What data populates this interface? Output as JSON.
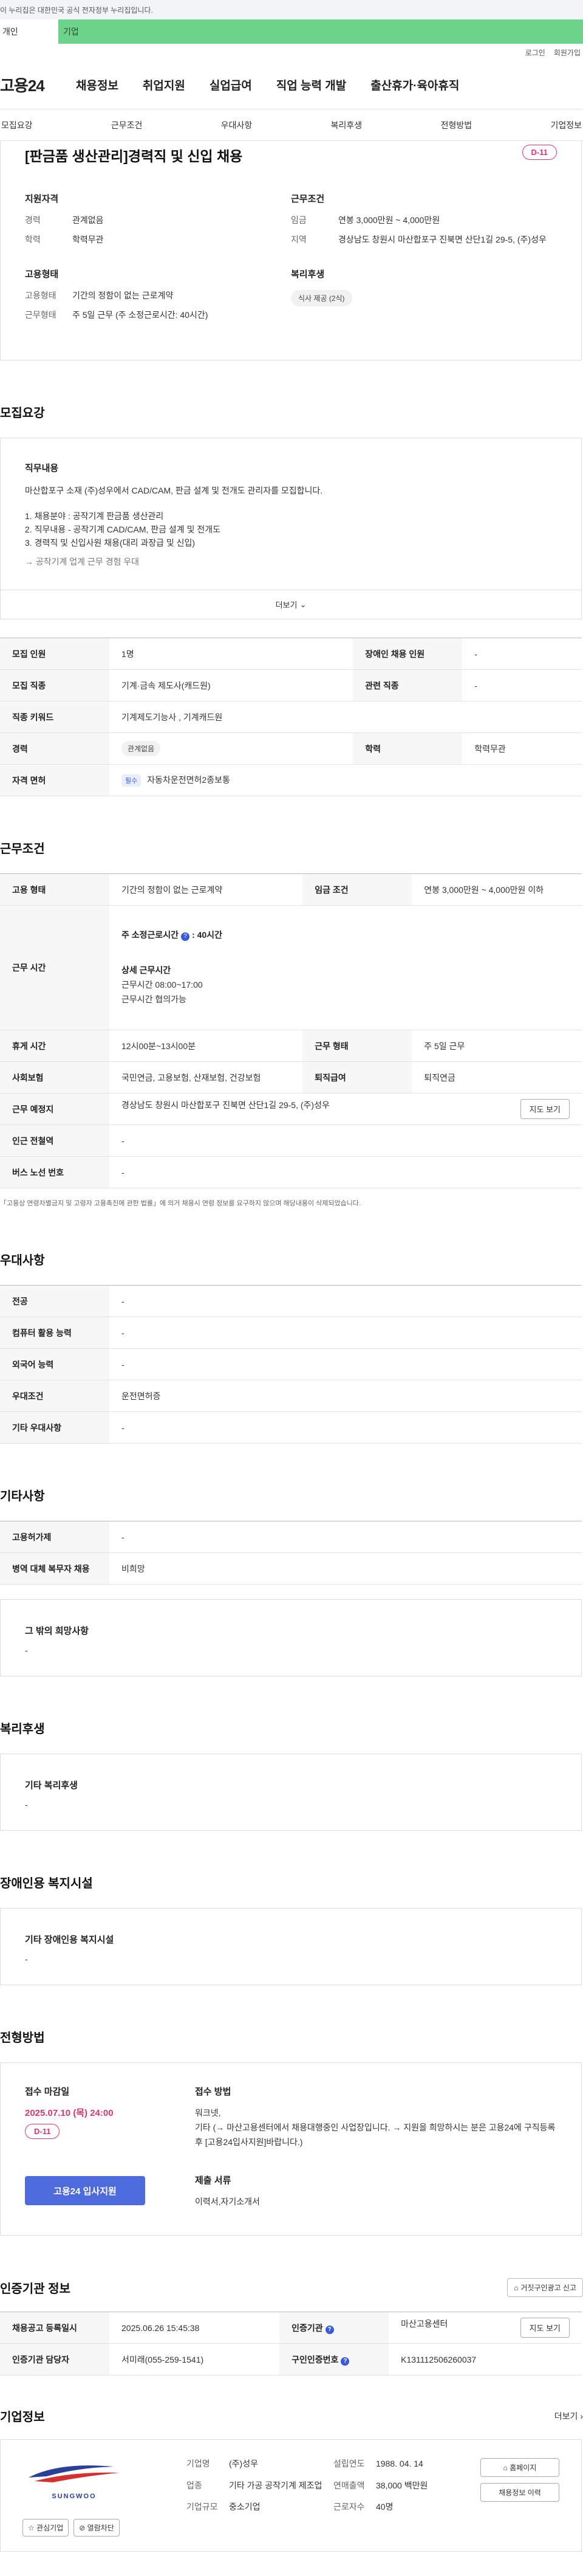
{
  "banner": {
    "text": "이 누리집은 대한민국 공식 전자정부 누리집입니다."
  },
  "user_tabs": {
    "personal": "개인",
    "company": "기업"
  },
  "util": {
    "login": "로그인",
    "join": "회원가입"
  },
  "gnb": {
    "logo": "고용24",
    "menu": [
      "채용정보",
      "취업지원",
      "실업급여",
      "직업 능력 개발",
      "출산휴가·육아휴직"
    ]
  },
  "subnav": [
    "모집요강",
    "근무조건",
    "우대사항",
    "복리후생",
    "전형방법",
    "기업정보"
  ],
  "summary": {
    "title": "[판금품 생산관리]경력직 및 신입 채용",
    "dday": "D-11",
    "qual_head": "지원자격",
    "qual": [
      {
        "k": "경력",
        "v": "관계없음"
      },
      {
        "k": "학력",
        "v": "학력무관"
      }
    ],
    "emp_head": "고용형태",
    "emp": [
      {
        "k": "고용형태",
        "v": "기간의 정함이 없는 근로계약"
      },
      {
        "k": "근무형태",
        "v": "주 5일 근무 (주 소정근로시간: 40시간)"
      }
    ],
    "work_head": "근무조건",
    "work": [
      {
        "k": "임금",
        "v": "연봉 3,000만원 ~ 4,000만원"
      },
      {
        "k": "지역",
        "v": "경상남도 창원시 마산합포구 진북면 산단1길 29-5, (주)성우"
      }
    ],
    "welfare_head": "복리후생",
    "welfare_chip": "식사 제공 (2식)"
  },
  "recruit": {
    "title": "모집요강",
    "duty_head": "직무내용",
    "lines": [
      "마산합포구 소재 (주)성우에서 CAD/CAM, 판금 설계 및 전개도 관리자를 모집합니다.",
      "",
      "1. 채용분야 : 공작기계 판금품 생산관리",
      "2. 직무내용 - 공작기계 CAD/CAM, 판금 설계 및 전개도",
      "3. 경력직 및 신입사원 채용(대리 과장급 및 신입)"
    ],
    "note": "→ 공작기계 업계 근무 경험 우대",
    "more": "더보기"
  },
  "recruit_table": {
    "r1": {
      "k1": "모집 인원",
      "v1": "1명",
      "k2": "장애인 채용 인원",
      "v2": "-"
    },
    "r2": {
      "k1": "모집 직종",
      "v1": "기계·금속 제도사(캐드원)",
      "k2": "관련 직종",
      "v2": "-"
    },
    "r3": {
      "k1": "직종 키워드",
      "v1": "기계제도기능사 , 기계캐드원"
    },
    "r4": {
      "k1": "경력",
      "v1": "관계없음",
      "k2": "학력",
      "v2": "학력무관"
    },
    "r5": {
      "k1": "자격 면허",
      "badge": "필수",
      "v1": "자동차운전면허2종보통"
    }
  },
  "conditions": {
    "title": "근무조건",
    "r1": {
      "k1": "고용 형태",
      "v1": "기간의 정함이 없는 근로계약",
      "k2": "임금 조건",
      "v2": "연봉 3,000만원 ~ 4,000만원 이하"
    },
    "hours": {
      "k": "근무 시간",
      "total_label": "주 소정근로시간",
      "total_value": ": 40시간",
      "detail_label": "상세 근무시간",
      "detail_1": "근무시간 08:00~17:00",
      "detail_2": "근무시간 협의가능"
    },
    "r3": {
      "k1": "휴게 시간",
      "v1": "12시00분~13시00분",
      "k2": "근무 형태",
      "v2": "주 5일 근무"
    },
    "r4": {
      "k1": "사회보험",
      "v1": "국민연금, 고용보험, 산재보험, 건강보험",
      "k2": "퇴직급여",
      "v2": "퇴직연금"
    },
    "r5": {
      "k1": "근무 예정지",
      "v1": "경상남도 창원시 마산합포구 진북면 산단1길 29-5, (주)성우",
      "btn": "지도 보기"
    },
    "r6": {
      "k1": "인근 전철역",
      "v1": "-"
    },
    "r7": {
      "k1": "버스 노선 번호",
      "v1": "-"
    },
    "footnote": "「고용상 연령차별금지 및 고령자 고용촉진에 관한 법률」에 의거 채용시 연령 정보를 요구하지 않으며 해당내용이 삭제되었습니다."
  },
  "preference": {
    "title": "우대사항",
    "rows": [
      {
        "k": "전공",
        "v": "-"
      },
      {
        "k": "컴퓨터 활용 능력",
        "v": "-"
      },
      {
        "k": "외국어 능력",
        "v": "-"
      },
      {
        "k": "우대조건",
        "v": "운전면허증"
      },
      {
        "k": "기타 우대사항",
        "v": "-"
      }
    ]
  },
  "others": {
    "title": "기타사항",
    "rows": [
      {
        "k": "고용허가제",
        "v": "-"
      },
      {
        "k": "병역 대체 복무자 채용",
        "v": "비희망"
      }
    ],
    "wish_head": "그 밖의 희망사항",
    "wish_val": "-"
  },
  "welfare": {
    "title": "복리후생",
    "head": "기타 복리후생",
    "val": "-"
  },
  "disability": {
    "title": "장애인용 복지시설",
    "head": "기타 장애인용 복지시설",
    "val": "-"
  },
  "process": {
    "title": "전형방법",
    "deadline_head": "접수 마감일",
    "deadline": "2025.07.10 (목) 24:00",
    "dday": "D-11",
    "apply": "고용24 입사지원",
    "method_head": "접수 방법",
    "method_1": "워크넷,",
    "method_2": "기타 (→ 마산고용센터에서 채용대행중인 사업장입니다. → 지원을 희망하시는 분은 고용24에 구직등록 후 [고용24입사지원]바랍니다.)",
    "docs_head": "제출 서류",
    "docs": "이력서,자기소개서"
  },
  "cert": {
    "title": "인증기관 정보",
    "report_btn": "거짓구인광고 신고",
    "r1": {
      "k1": "채용공고 등록일시",
      "v1": "2025.06.26 15:45:38",
      "k2": "인증기관",
      "v2": "마산고용센터",
      "btn": "지도 보기"
    },
    "r2": {
      "k1": "인증기관 담당자",
      "v1": "서미래(055-259-1541)",
      "k2": "구인인증번호",
      "v2": "K131112506260037"
    }
  },
  "company": {
    "title": "기업정보",
    "more": "더보기",
    "logo_text": "SUNGWOO",
    "interest": "관심기업",
    "block": "열람차단",
    "c1": [
      {
        "k": "기업명",
        "v": "(주)성우"
      },
      {
        "k": "업종",
        "v": "기타 가공 공작기계 제조업"
      },
      {
        "k": "기업규모",
        "v": "중소기업"
      }
    ],
    "c2": [
      {
        "k": "설립연도",
        "v": "1988. 04. 14"
      },
      {
        "k": "연매출액",
        "v": "38,000 백만원"
      },
      {
        "k": "근로자수",
        "v": "40명"
      }
    ],
    "homepage": "홈페이지",
    "other_jobs": "채용정보 이력"
  },
  "colors": {
    "accent": "#4d6bdc",
    "dday": "#e0356f",
    "company_tab": "#6dd38a"
  }
}
